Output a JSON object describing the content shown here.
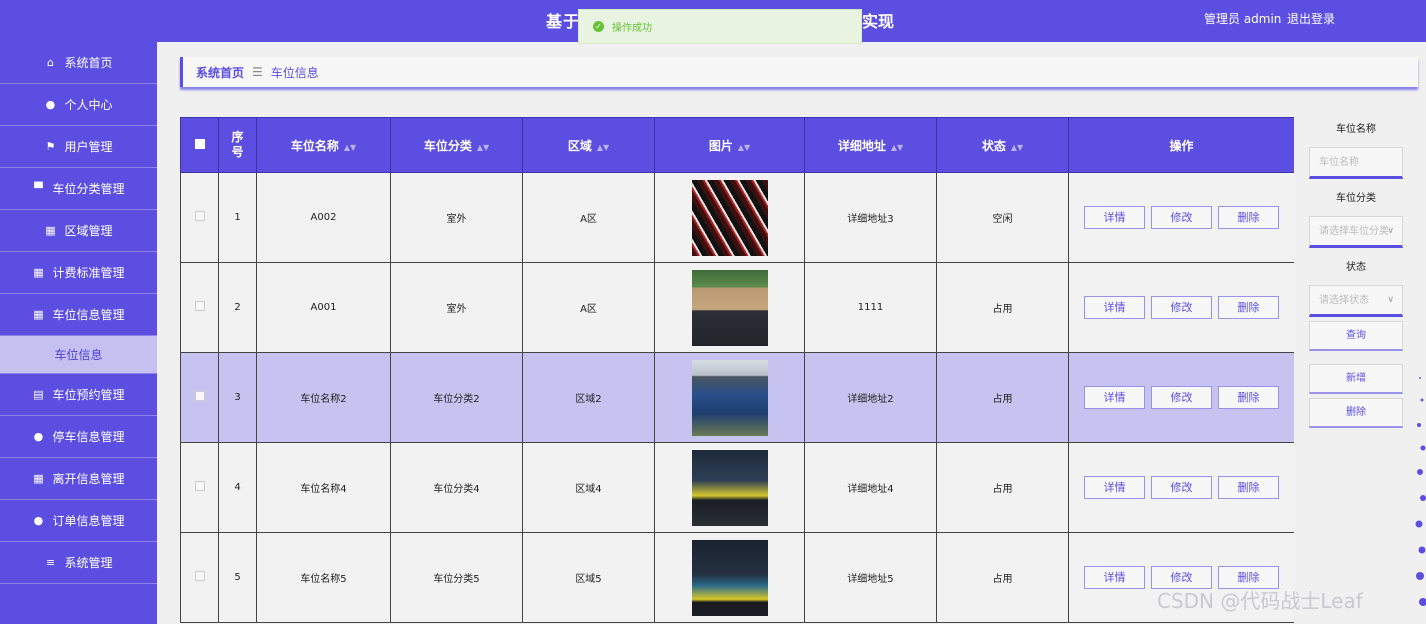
{
  "header": {
    "title_start": "基于",
    "title_end": "实现",
    "user_label": "管理员 admin",
    "logout": "退出登录"
  },
  "toast": {
    "message": "操作成功"
  },
  "sidebar": {
    "items": [
      {
        "label": "系统首页",
        "icon": "home-icon"
      },
      {
        "label": "个人中心",
        "icon": "user-icon"
      },
      {
        "label": "用户管理",
        "icon": "flag-icon"
      },
      {
        "label": "车位分类管理",
        "icon": "monitor-icon"
      },
      {
        "label": "区域管理",
        "icon": "grid-icon"
      },
      {
        "label": "计费标准管理",
        "icon": "grid-icon"
      },
      {
        "label": "车位信息管理",
        "icon": "grid-icon"
      },
      {
        "label": "车位信息",
        "icon": ""
      },
      {
        "label": "车位预约管理",
        "icon": "table-icon"
      },
      {
        "label": "停车信息管理",
        "icon": "user-icon"
      },
      {
        "label": "离开信息管理",
        "icon": "grid-icon"
      },
      {
        "label": "订单信息管理",
        "icon": "user-icon"
      },
      {
        "label": "系统管理",
        "icon": "menu-icon"
      }
    ]
  },
  "breadcrumb": {
    "home": "系统首页",
    "sep": "☰",
    "current": "车位信息"
  },
  "table": {
    "headers": {
      "index": "序号",
      "name": "车位名称",
      "category": "车位分类",
      "area": "区域",
      "image": "图片",
      "address": "详细地址",
      "status": "状态",
      "actions": "操作"
    },
    "action_labels": {
      "detail": "详情",
      "edit": "修改",
      "delete": "删除"
    },
    "rows": [
      {
        "index": "1",
        "name": "A002",
        "category": "室外",
        "area": "A区",
        "address": "详细地址3",
        "status": "空闲"
      },
      {
        "index": "2",
        "name": "A001",
        "category": "室外",
        "area": "A区",
        "address": "1111",
        "status": "占用"
      },
      {
        "index": "3",
        "name": "车位名称2",
        "category": "车位分类2",
        "area": "区域2",
        "address": "详细地址2",
        "status": "占用"
      },
      {
        "index": "4",
        "name": "车位名称4",
        "category": "车位分类4",
        "area": "区域4",
        "address": "详细地址4",
        "status": "占用"
      },
      {
        "index": "5",
        "name": "车位名称5",
        "category": "车位分类5",
        "area": "区域5",
        "address": "详细地址5",
        "status": "占用"
      }
    ]
  },
  "filters": {
    "name_label": "车位名称",
    "name_placeholder": "车位名称",
    "category_label": "车位分类",
    "category_placeholder": "请选择车位分类",
    "status_label": "状态",
    "status_placeholder": "请选择状态",
    "search": "查询",
    "add": "新增",
    "delete": "删除"
  },
  "watermark": "CSDN @代码战士Leaf",
  "colors": {
    "primary": "#5b4ee0",
    "highlight_row": "#c7c3f0",
    "success": "#67c23a"
  }
}
